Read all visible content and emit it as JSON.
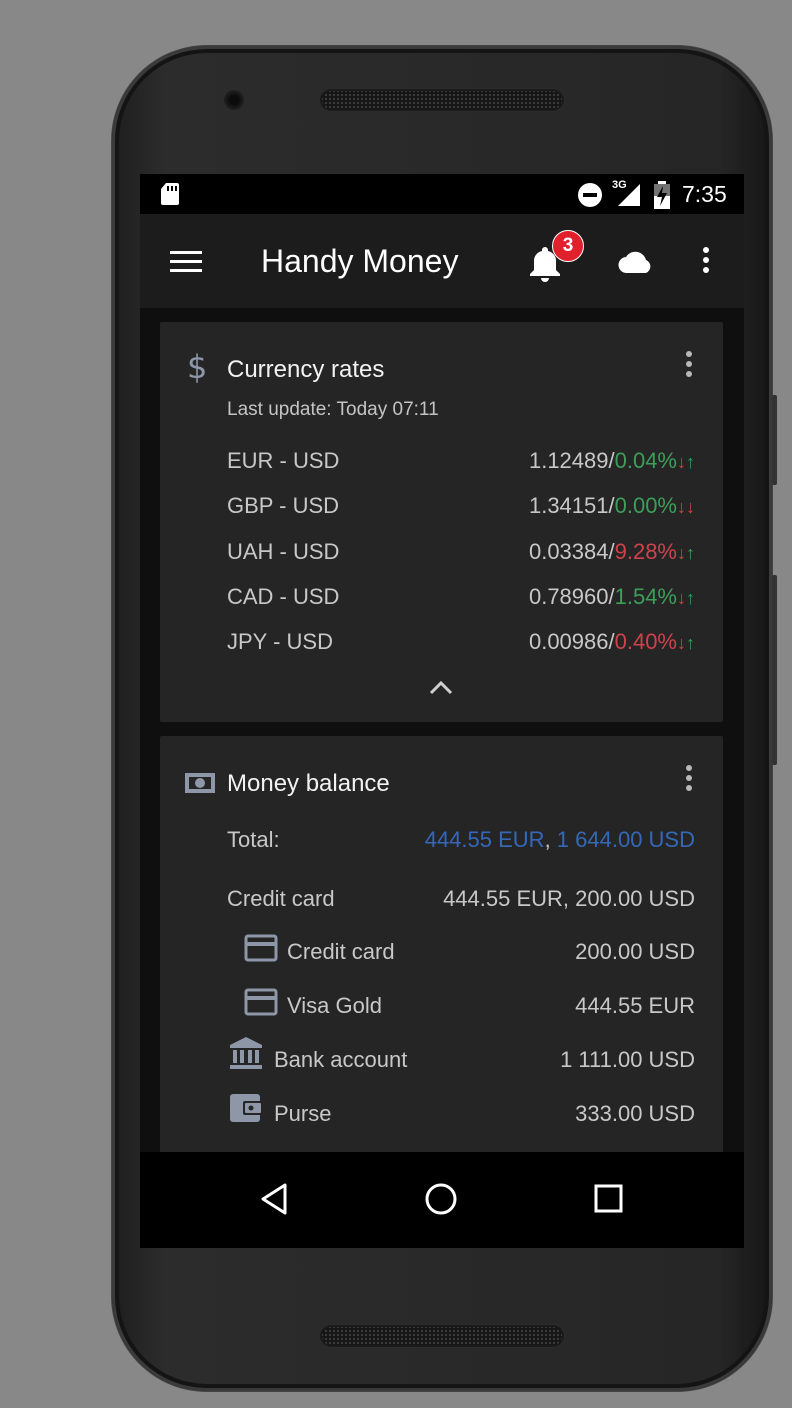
{
  "status_bar": {
    "time": "7:35",
    "network": "3G",
    "icons": [
      "sd-card-icon",
      "do-not-disturb-icon",
      "signal-icon",
      "battery-charging-icon"
    ]
  },
  "app_bar": {
    "title": "Handy Money",
    "notification_count": "3",
    "icons": [
      "menu-icon",
      "bell-icon",
      "cloud-icon",
      "more-vert-icon"
    ]
  },
  "currency_card": {
    "icon": "dollar-icon",
    "title": "Currency rates",
    "last_update": "Last update: Today 07:11",
    "rows": [
      {
        "pair": "EUR - USD",
        "rate": "1.12489/",
        "change": "0.04%",
        "change_color": "green",
        "arrows": [
          {
            "symbol": "↓",
            "color": "red"
          },
          {
            "symbol": "↑",
            "color": "green"
          }
        ]
      },
      {
        "pair": "GBP - USD",
        "rate": "1.34151/",
        "change": "0.00%",
        "change_color": "green",
        "arrows": [
          {
            "symbol": "↓",
            "color": "red"
          },
          {
            "symbol": "↓",
            "color": "red"
          }
        ]
      },
      {
        "pair": "UAH - USD",
        "rate": "0.03384/",
        "change": "9.28%",
        "change_color": "red",
        "arrows": [
          {
            "symbol": "↓",
            "color": "red"
          },
          {
            "symbol": "↑",
            "color": "green"
          }
        ]
      },
      {
        "pair": "CAD - USD",
        "rate": "0.78960/",
        "change": "1.54%",
        "change_color": "green",
        "arrows": [
          {
            "symbol": "↓",
            "color": "red"
          },
          {
            "symbol": "↑",
            "color": "green"
          }
        ]
      },
      {
        "pair": "JPY - USD",
        "rate": "0.00986/",
        "change": "0.40%",
        "change_color": "red",
        "arrows": [
          {
            "symbol": "↓",
            "color": "red"
          },
          {
            "symbol": "↑",
            "color": "green"
          }
        ]
      }
    ],
    "collapse_icon": "chevron-up-icon"
  },
  "balance_card": {
    "icon": "money-icon",
    "title": "Money balance",
    "total_label": "Total:",
    "total_eur": "444.55 EUR",
    "total_sep": ", ",
    "total_usd": "1 644.00 USD",
    "group_label": "Credit card",
    "group_value": "444.55 EUR, 200.00 USD",
    "accounts": [
      {
        "icon": "credit-card-icon",
        "label": "Credit card",
        "value": "200.00 USD"
      },
      {
        "icon": "credit-card-icon",
        "label": "Visa Gold",
        "value": "444.55 EUR"
      },
      {
        "icon": "bank-icon",
        "label": "Bank account",
        "value": "1 111.00 USD"
      },
      {
        "icon": "wallet-icon",
        "label": "Purse",
        "value": "333.00 USD"
      }
    ]
  },
  "nav_bar": {
    "icons": [
      "back-icon",
      "home-icon",
      "recents-icon"
    ]
  },
  "colors": {
    "positive": "#3d9e5a",
    "negative": "#d0424b",
    "total": "#3568b8",
    "badge": "#e0202c",
    "icon_gray": "#8d97a8"
  }
}
